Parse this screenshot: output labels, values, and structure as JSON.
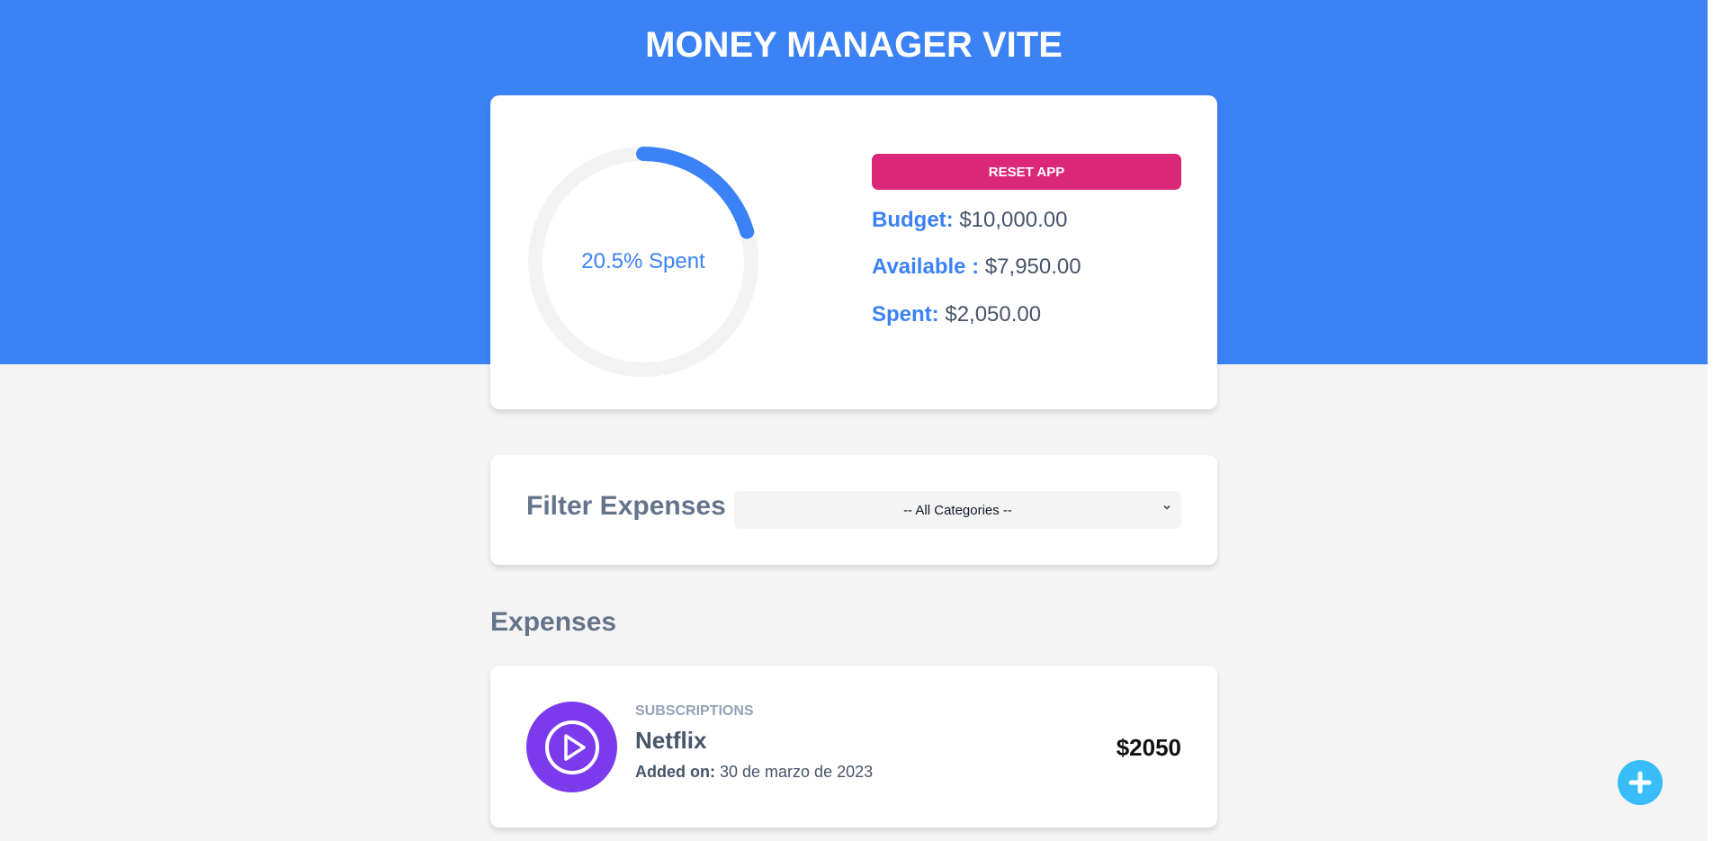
{
  "header": {
    "title": "MONEY MANAGER VITE"
  },
  "budget": {
    "progress_label": "20.5% Spent",
    "progress_percent": 20.5,
    "reset_label": "RESET APP",
    "budget_label": "Budget:",
    "budget_value": "$10,000.00",
    "available_label": "Available :",
    "available_value": "$7,950.00",
    "spent_label": "Spent:",
    "spent_value": "$2,050.00"
  },
  "filter": {
    "label": "Filter Expenses",
    "selected": "-- All Categories --"
  },
  "expenses": {
    "heading": "Expenses",
    "items": [
      {
        "category": "SUBSCRIPTIONS",
        "name": "Netflix",
        "date_label": "Added on:",
        "date_value": "30 de marzo de 2023",
        "amount": "$2050",
        "icon": "play-circle-icon"
      }
    ]
  },
  "colors": {
    "primary": "#3b82f6",
    "reset": "#db2777",
    "expense_icon_bg": "#7c3aed",
    "fab": "#38bdf8",
    "track": "#f3f3f3"
  },
  "fab": {
    "icon": "plus-icon"
  }
}
